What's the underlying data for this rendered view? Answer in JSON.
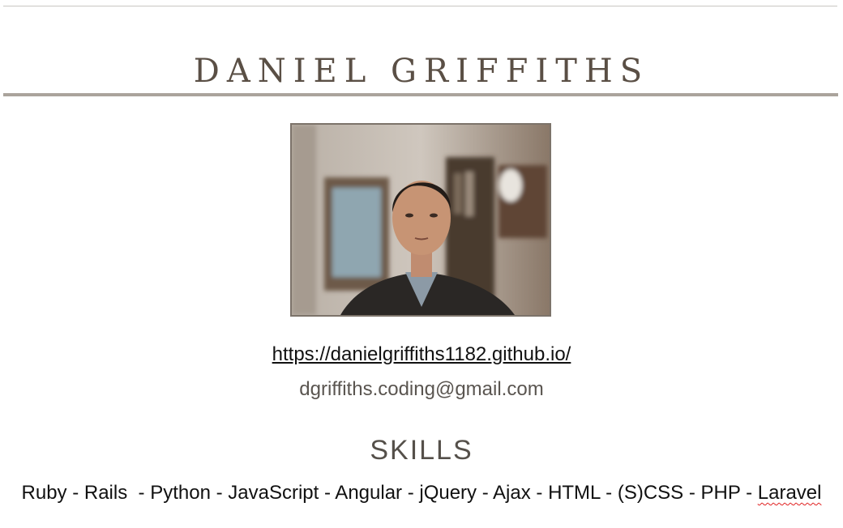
{
  "header": {
    "name": "DANIEL GRIFFITHS"
  },
  "photo": {
    "subject": "portrait photo"
  },
  "contact": {
    "website": "https://danielgriffiths1182.github.io/",
    "email": "dgriffiths.coding@gmail.com"
  },
  "skills": {
    "heading": "SKILLS",
    "list_prefix": "Ruby - Rails  - Python - JavaScript - Angular - jQuery - Ajax - HTML - (S)CSS - PHP - ",
    "last_item": "Laravel"
  },
  "colors": {
    "accent": "#5a4f45",
    "rule": "#aaa39c",
    "spellcheck": "#e02020"
  }
}
